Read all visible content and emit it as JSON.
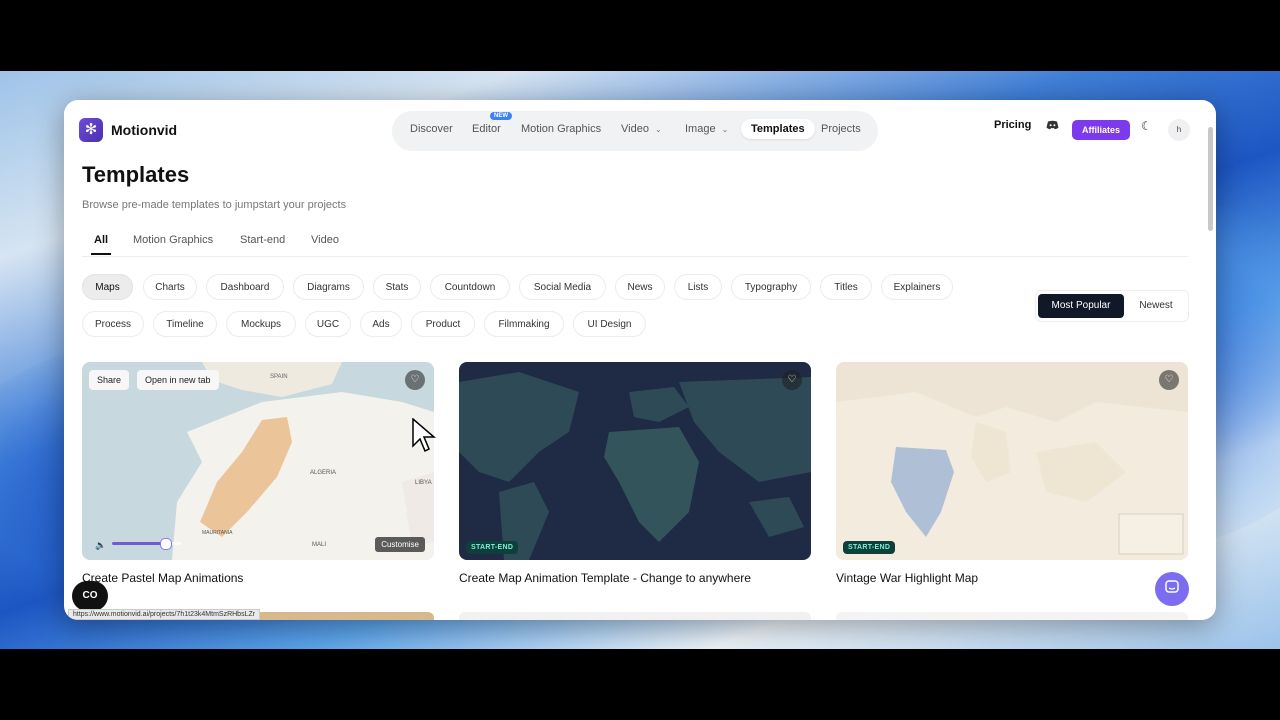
{
  "brand": {
    "name": "Motionvid",
    "logo_icon": "flower-logo-icon"
  },
  "nav": {
    "items": [
      {
        "label": "Discover"
      },
      {
        "label": "Editor",
        "badge": "NEW"
      },
      {
        "label": "Motion Graphics"
      },
      {
        "label": "Video",
        "has_dropdown": true
      },
      {
        "label": "Image",
        "has_dropdown": true
      },
      {
        "label": "Templates",
        "active": true
      },
      {
        "label": "Projects"
      }
    ],
    "pricing": "Pricing",
    "discord_icon": "discord-icon",
    "affiliates": "Affiliates",
    "theme_icon": "moon-icon",
    "avatar": "h"
  },
  "page": {
    "title": "Templates",
    "subtitle": "Browse pre-made templates to jumpstart your projects"
  },
  "tabs": [
    {
      "label": "All",
      "active": true
    },
    {
      "label": "Motion Graphics"
    },
    {
      "label": "Start-end"
    },
    {
      "label": "Video"
    }
  ],
  "filters": {
    "row1": [
      "Maps",
      "Charts",
      "Dashboard",
      "Diagrams",
      "Stats",
      "Countdown",
      "Social Media",
      "News",
      "Lists",
      "Typography",
      "Titles",
      "Explainers"
    ],
    "row2": [
      "Process",
      "Timeline",
      "Mockups",
      "UGC",
      "Ads",
      "Product",
      "Filmmaking",
      "UI Design"
    ],
    "active": "Maps"
  },
  "sort": {
    "options": [
      "Most Popular",
      "Newest"
    ],
    "active": "Most Popular"
  },
  "cards": [
    {
      "title": "Create Pastel Map Animations",
      "share": "Share",
      "open_new_tab": "Open in new tab",
      "customise": "Customise",
      "map_labels": [
        "SPAIN",
        "ALGERIA",
        "MAURITANIA",
        "MALI",
        "LIBYA"
      ],
      "playback_progress": 0.75
    },
    {
      "title": "Create Map Animation Template - Change to anywhere",
      "tag": "START-END"
    },
    {
      "title": "Vintage War Highlight Map",
      "tag": "START-END"
    }
  ],
  "status_url": "https://www.motionvid.ai/projects/7h1t23k4MtmSzRHbsLZr",
  "cc_label": "CO",
  "chat_icon": "chat-bubble-icon",
  "colors": {
    "accent": "#7c3aed",
    "dark": "#111827",
    "tag_bg": "#0f3f3a",
    "tag_text": "#7df0d6"
  }
}
